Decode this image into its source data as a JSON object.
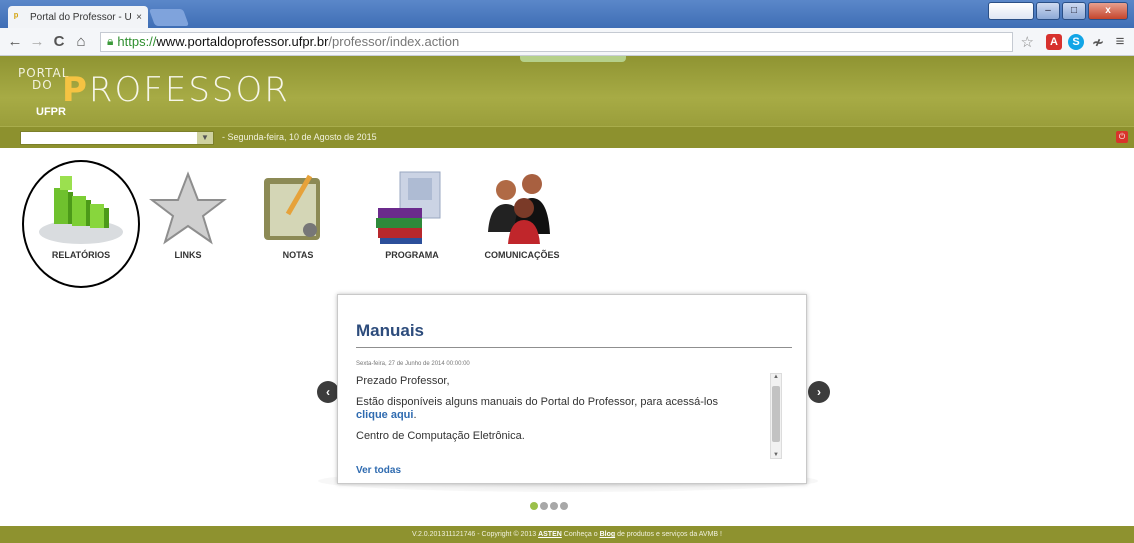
{
  "browser": {
    "tab_title": "Portal do Professor - UFPI",
    "tab_close": "×",
    "url_secure": "https://",
    "url_host": "www.portaldoprofessor.ufpr.br",
    "url_path": "/professor/index.action",
    "nav_back": "←",
    "nav_forward": "→",
    "nav_reload": "C",
    "nav_home": "⌂",
    "bookmark_star": "☆",
    "ext_1": "A",
    "ext_2": "S",
    "ext_3": "≁",
    "menu": "≡",
    "win_minimize": "–",
    "win_maximize": "□",
    "win_close": "x"
  },
  "header": {
    "logo_portal": "PORTAL",
    "logo_do": "DO",
    "logo_p": "P",
    "logo_rest": "ROFESSOR",
    "logo_ufpr": "UFPR"
  },
  "datebar": {
    "select_value": "",
    "date_text": "-  Segunda-feira, 10 de Agosto de 2015"
  },
  "menu": {
    "items": [
      {
        "label": "RELATÓRIOS",
        "icon": "bar-chart-icon"
      },
      {
        "label": "LINKS",
        "icon": "star-icon"
      },
      {
        "label": "NOTAS",
        "icon": "notepad-icon"
      },
      {
        "label": "PROGRAMA",
        "icon": "books-icon"
      },
      {
        "label": "COMUNICAÇÕES",
        "icon": "people-icon"
      }
    ]
  },
  "panel": {
    "title": "Manuais",
    "date": "Sexta-feira, 27 de Junho de 2014 00:00:00",
    "greeting": "Prezado Professor,",
    "body_text": "Estão disponíveis alguns manuais do Portal do Professor, para acessá-los",
    "body_link": "clique aqui",
    "body_end": ".",
    "signature": "Centro de Computação Eletrônica.",
    "more_link": "Ver todas",
    "prev": "‹",
    "next": "›"
  },
  "footer": {
    "text_before": "V.2.0.201311121746 - Copyright © 2013 ",
    "asten": "ASTEN",
    "text_mid": "  Conheça o ",
    "blog": "Blog",
    "text_after": " de produtos e serviços da AVMB !"
  },
  "colors": {
    "header_olive": "#8d912e",
    "logo_yellow": "#f5c342",
    "title_blue": "#2d4c7c",
    "link_blue": "#2f6bb0",
    "dot_active": "#9bc04a"
  }
}
